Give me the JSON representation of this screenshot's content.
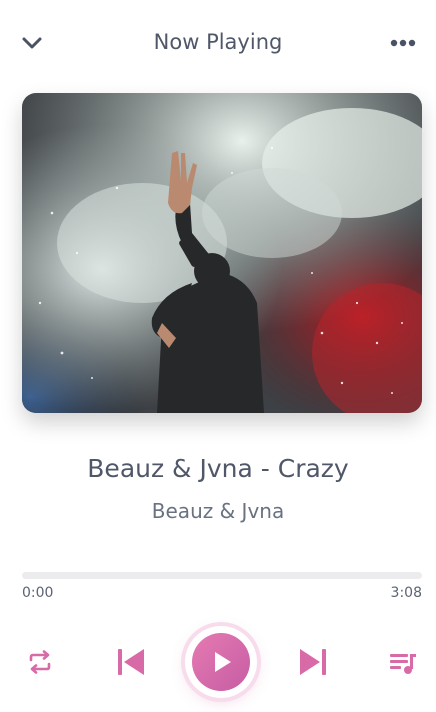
{
  "header": {
    "title": "Now Playing",
    "back_icon": "chevron-down-icon",
    "menu_icon": "more-horizontal-icon"
  },
  "track": {
    "title": "Beauz & Jvna - Crazy",
    "artist": "Beauz & Jvna"
  },
  "progress": {
    "elapsed": "0:00",
    "duration": "3:08",
    "fraction": 0
  },
  "controls": [
    "repeat-icon",
    "previous-icon",
    "play-icon",
    "next-icon",
    "queue-icon"
  ],
  "colors": {
    "accent": "#d86aa7",
    "text": "#4f5768",
    "track_bg": "#ececee"
  }
}
